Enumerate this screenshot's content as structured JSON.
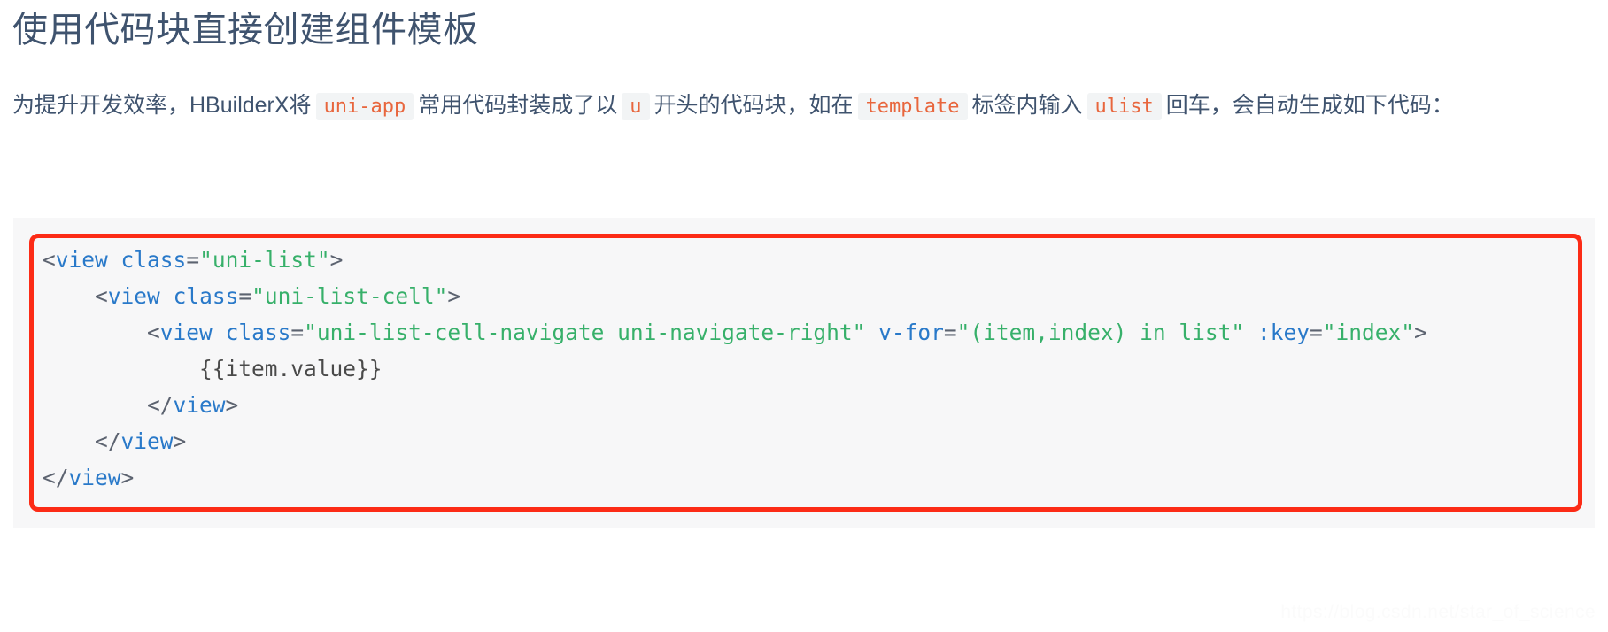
{
  "document": {
    "title": "使用代码块直接创建组件模板",
    "paragraph": {
      "segments": [
        {
          "kind": "text",
          "value": "为提升开发效率，HBuilderX将"
        },
        {
          "kind": "code",
          "value": "uni-app"
        },
        {
          "kind": "text",
          "value": "常用代码封装成了以"
        },
        {
          "kind": "code",
          "value": "u"
        },
        {
          "kind": "text",
          "value": "开头的代码块，如在"
        },
        {
          "kind": "code",
          "value": "template"
        },
        {
          "kind": "text",
          "value": "标签内输入"
        },
        {
          "kind": "code",
          "value": "ulist"
        },
        {
          "kind": "text",
          "value": "回车，会自动生成如下代码："
        }
      ],
      "inline_code_color": "#e8663d",
      "inline_code_background": "#f2f4f5",
      "text_color": "#3f536e"
    },
    "code_block": {
      "language": "html",
      "background": "#f7f7f8",
      "highlight_border_color": "#fc2b16",
      "lines": [
        {
          "indent": 0,
          "tokens": [
            {
              "t": "punct",
              "v": "<"
            },
            {
              "t": "tag",
              "v": "view"
            },
            {
              "t": "text",
              "v": " "
            },
            {
              "t": "attr",
              "v": "class"
            },
            {
              "t": "punct",
              "v": "="
            },
            {
              "t": "str",
              "v": "\"uni-list\""
            },
            {
              "t": "punct",
              "v": ">"
            }
          ]
        },
        {
          "indent": 1,
          "tokens": [
            {
              "t": "punct",
              "v": "<"
            },
            {
              "t": "tag",
              "v": "view"
            },
            {
              "t": "text",
              "v": " "
            },
            {
              "t": "attr",
              "v": "class"
            },
            {
              "t": "punct",
              "v": "="
            },
            {
              "t": "str",
              "v": "\"uni-list-cell\""
            },
            {
              "t": "punct",
              "v": ">"
            }
          ]
        },
        {
          "indent": 2,
          "tokens": [
            {
              "t": "punct",
              "v": "<"
            },
            {
              "t": "tag",
              "v": "view"
            },
            {
              "t": "text",
              "v": " "
            },
            {
              "t": "attr",
              "v": "class"
            },
            {
              "t": "punct",
              "v": "="
            },
            {
              "t": "str",
              "v": "\"uni-list-cell-navigate uni-navigate-right\""
            },
            {
              "t": "text",
              "v": " "
            },
            {
              "t": "attr",
              "v": "v-for"
            },
            {
              "t": "punct",
              "v": "="
            },
            {
              "t": "str",
              "v": "\"(item,index) in list\""
            },
            {
              "t": "text",
              "v": " "
            },
            {
              "t": "attr",
              "v": ":key"
            },
            {
              "t": "punct",
              "v": "="
            },
            {
              "t": "str",
              "v": "\"index\""
            },
            {
              "t": "punct",
              "v": ">"
            }
          ]
        },
        {
          "indent": 3,
          "tokens": [
            {
              "t": "text",
              "v": "{{item.value}}"
            }
          ]
        },
        {
          "indent": 2,
          "tokens": [
            {
              "t": "punct",
              "v": "</"
            },
            {
              "t": "tag",
              "v": "view"
            },
            {
              "t": "punct",
              "v": ">"
            }
          ]
        },
        {
          "indent": 1,
          "tokens": [
            {
              "t": "punct",
              "v": "</"
            },
            {
              "t": "tag",
              "v": "view"
            },
            {
              "t": "punct",
              "v": ">"
            }
          ]
        },
        {
          "indent": 0,
          "tokens": [
            {
              "t": "punct",
              "v": "</"
            },
            {
              "t": "tag",
              "v": "view"
            },
            {
              "t": "punct",
              "v": ">"
            }
          ]
        }
      ]
    },
    "watermark": "https://blog.csdn.net/star_of_science"
  }
}
